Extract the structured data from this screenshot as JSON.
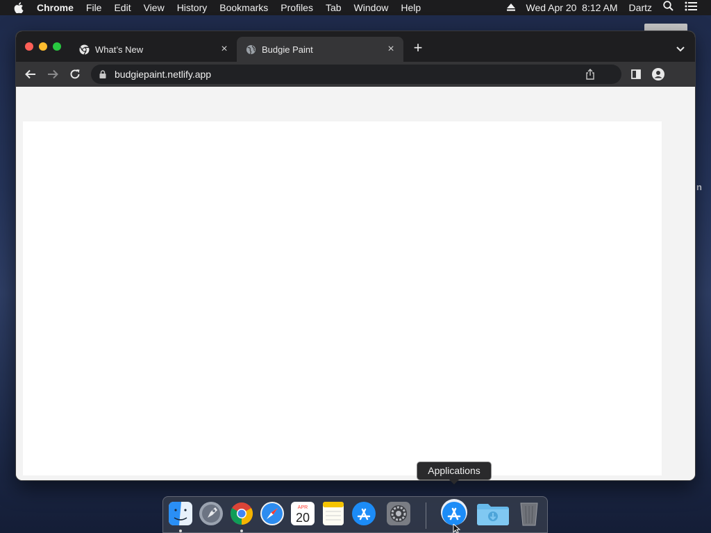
{
  "menubar": {
    "app_name": "Chrome",
    "menus": [
      "File",
      "Edit",
      "View",
      "History",
      "Bookmarks",
      "Profiles",
      "Tab",
      "Window",
      "Help"
    ],
    "datetime": "Wed Apr 20  8:12 AM",
    "user": "Dartz"
  },
  "desktop": {
    "partial_label": "n"
  },
  "browser": {
    "tabs": [
      {
        "title": "What’s New",
        "active": false
      },
      {
        "title": "Budgie Paint",
        "active": true
      }
    ],
    "url": "budgiepaint.netlify.app"
  },
  "dock": {
    "tooltip": "Applications",
    "calendar_month": "APR",
    "calendar_day": "20",
    "items": [
      "finder-icon",
      "launchpad-icon",
      "chrome-icon",
      "safari-icon",
      "calendar-icon",
      "notes-icon",
      "app-store-icon",
      "system-preferences-icon",
      "applications-folder-icon",
      "downloads-folder-icon",
      "trash-icon"
    ]
  },
  "colors": {
    "menubar": "#1c1c1e",
    "tabstrip": "#1e1e20",
    "toolbar": "#353537",
    "page_bg": "#f3f3f3",
    "canvas": "#ffffff"
  }
}
